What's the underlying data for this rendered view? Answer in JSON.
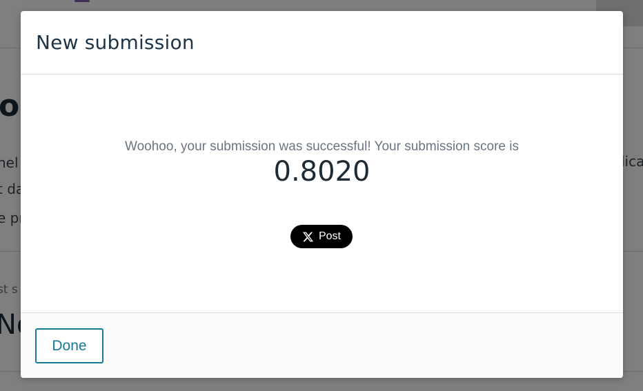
{
  "background": {
    "heading_fragment": "or",
    "text_lines": [
      "hel",
      "t da",
      "e pr"
    ],
    "text_right_fragment": "lica",
    "small_text": "st s",
    "big_text": "No"
  },
  "modal": {
    "title": "New submission",
    "success_message": "Woohoo, your submission was successful! Your submission score is",
    "score": "0.8020",
    "share_button": {
      "icon": "x-logo-icon",
      "label": "Post"
    },
    "done_label": "Done"
  },
  "colors": {
    "overlay": "rgba(0,0,0,0.5)",
    "title": "#1e3447",
    "accent": "#157a96",
    "share_button_bg": "#000000"
  }
}
